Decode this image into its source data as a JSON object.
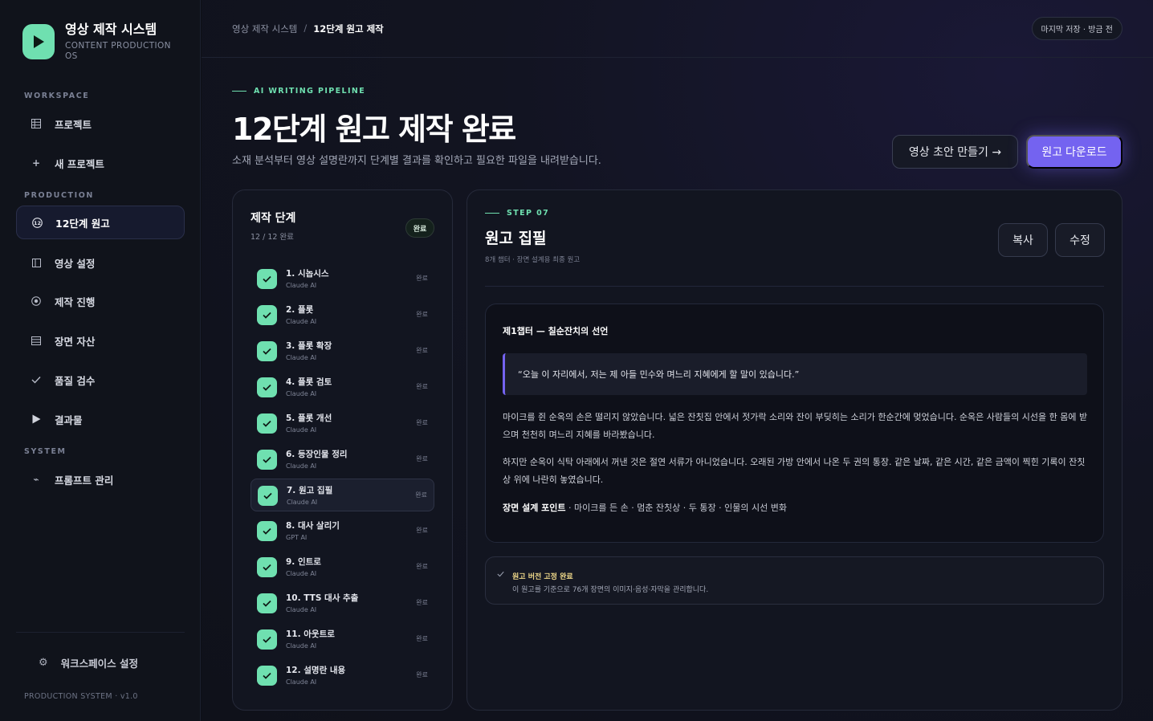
{
  "brand": {
    "title": "영상 제작 시스템",
    "subtitle": "CONTENT PRODUCTION OS",
    "accent": "#6fe0b0"
  },
  "sidebar": {
    "sections": {
      "workspace": "WORKSPACE",
      "production": "PRODUCTION",
      "system": "SYSTEM"
    },
    "items": [
      {
        "label": "프로젝트",
        "icon": "grid-icon"
      },
      {
        "label": "새 프로젝트",
        "icon": "plus-icon"
      },
      {
        "label": "12단계 원고",
        "icon": "number-12-icon",
        "active": true
      },
      {
        "label": "영상 설정",
        "icon": "panel-icon"
      },
      {
        "label": "제작 진행",
        "icon": "target-icon"
      },
      {
        "label": "장면 자산",
        "icon": "list-icon"
      },
      {
        "label": "품질 검수",
        "icon": "check-icon"
      },
      {
        "label": "결과물",
        "icon": "play-icon"
      },
      {
        "label": "프롬프트 관리",
        "icon": "wave-icon"
      }
    ],
    "footer_setting": "워크스페이스 설정",
    "version": "PRODUCTION SYSTEM · v1.0"
  },
  "topbar": {
    "breadcrumb_root": "영상 제작 시스템",
    "breadcrumb_sep": "/",
    "breadcrumb_current": "12단계 원고 제작",
    "save_status": "마지막 저장 · 방금 전"
  },
  "header": {
    "eyebrow": "AI WRITING PIPELINE",
    "title": "12단계 원고 제작 완료",
    "description": "소재 분석부터 영상 설명란까지 단계별 결과를 확인하고 필요한 파일을 내려받습니다.",
    "btn_draft": "영상 초안 만들기 →",
    "btn_download": "원고 다운로드",
    "primary_color": "#7463f0"
  },
  "steps": {
    "title": "제작 단계",
    "count": "12 / 12 완료",
    "badge": "완료",
    "items": [
      {
        "name": "1. 시놉시스",
        "model": "Claude AI",
        "status": "완료"
      },
      {
        "name": "2. 플롯",
        "model": "Claude AI",
        "status": "완료"
      },
      {
        "name": "3. 플롯 확장",
        "model": "Claude AI",
        "status": "완료"
      },
      {
        "name": "4. 플롯 검토",
        "model": "Claude AI",
        "status": "완료"
      },
      {
        "name": "5. 플롯 개선",
        "model": "Claude AI",
        "status": "완료"
      },
      {
        "name": "6. 등장인물 정리",
        "model": "Claude AI",
        "status": "완료"
      },
      {
        "name": "7. 원고 집필",
        "model": "Claude AI",
        "status": "완료",
        "active": true
      },
      {
        "name": "8. 대사 살리기",
        "model": "GPT AI",
        "status": "완료"
      },
      {
        "name": "9. 인트로",
        "model": "Claude AI",
        "status": "완료"
      },
      {
        "name": "10. TTS 대사 추출",
        "model": "Claude AI",
        "status": "완료"
      },
      {
        "name": "11. 아웃트로",
        "model": "Claude AI",
        "status": "완료"
      },
      {
        "name": "12. 설명란 내용",
        "model": "Claude AI",
        "status": "완료"
      }
    ]
  },
  "content": {
    "step_label": "STEP 07",
    "title": "원고 집필",
    "subtitle": "8개 챕터 · 장면 설계용 최종 원고",
    "btn_copy": "복사",
    "btn_edit": "수정",
    "chapter_title": "제1챕터 — 칠순잔치의 선언",
    "quote": "“오늘 이 자리에서, 저는 제 아들 민수와 며느리 지혜에게 할 말이 있습니다.”",
    "para1": "마이크를 쥔 순옥의 손은 떨리지 않았습니다. 넓은 잔칫집 안에서 젓가락 소리와 잔이 부딪히는 소리가 한순간에 멎었습니다. 순옥은 사람들의 시선을 한 몸에 받으며 천천히 며느리 지혜를 바라봤습니다.",
    "para2": "하지만 순옥이 식탁 아래에서 꺼낸 것은 절연 서류가 아니었습니다. 오래된 가방 안에서 나온 두 권의 통장. 같은 날짜, 같은 시간, 같은 금액이 찍힌 기록이 잔칫상 위에 나란히 놓였습니다.",
    "point_label": "장면 설계 포인트",
    "point_text": " · 마이크를 든 손 · 멈춘 잔칫상 · 두 통장 · 인물의 시선 변화",
    "notice_title": "원고 버전 고정 완료",
    "notice_text": "이 원고를 기준으로 76개 장면의 이미지·음성·자막을 관리합니다."
  }
}
